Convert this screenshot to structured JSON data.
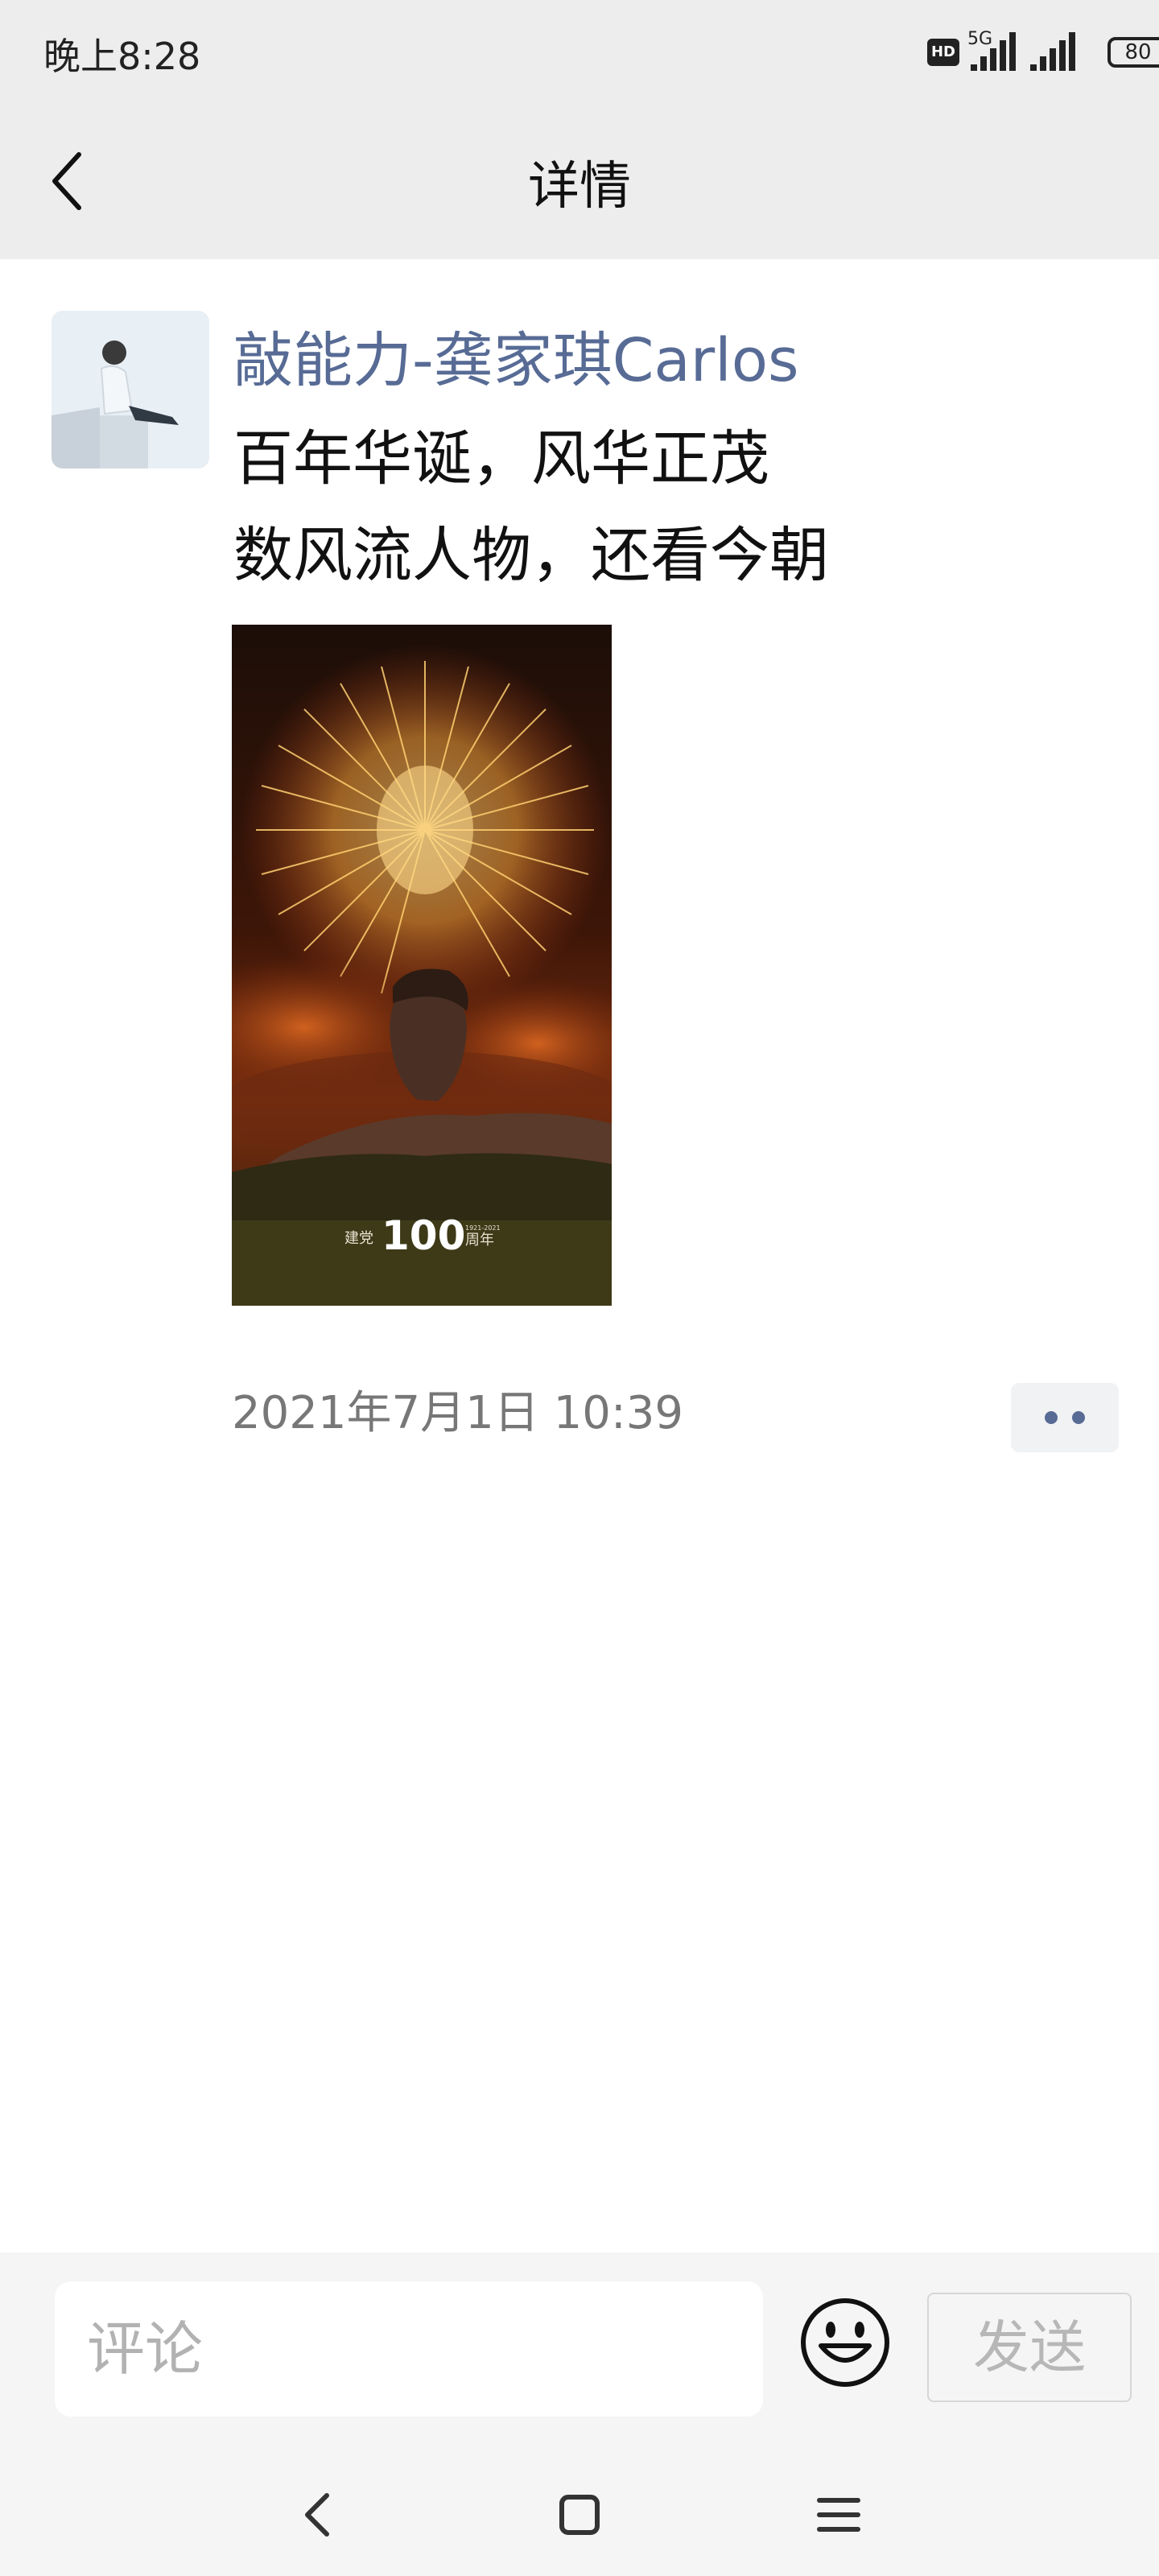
{
  "status_bar": {
    "time": "晚上8:28",
    "hd_badge": "HD",
    "network": "5G",
    "battery": "80"
  },
  "nav": {
    "back_icon": "chevron-left-icon",
    "title": "详情"
  },
  "post": {
    "author": "敲能力-龚家琪Carlos",
    "lines": [
      "百年华诞，风华正茂",
      "数风流人物，还看今朝"
    ],
    "image": {
      "caption_left": "建党",
      "caption_number": "100",
      "caption_right": "周年",
      "caption_years": "1921-2021"
    },
    "timestamp": "2021年7月1日 10:39",
    "more_icon": "more-dots-icon"
  },
  "comment_bar": {
    "placeholder": "评论",
    "value": "",
    "emoji_icon": "smiley-icon",
    "send_label": "发送"
  },
  "system_nav": {
    "back_icon": "back-icon",
    "home_icon": "home-icon",
    "menu_icon": "menu-icon"
  },
  "colors": {
    "author": "#576b95",
    "bar_bg": "#ededed",
    "bottom_bg": "#f5f5f5"
  }
}
